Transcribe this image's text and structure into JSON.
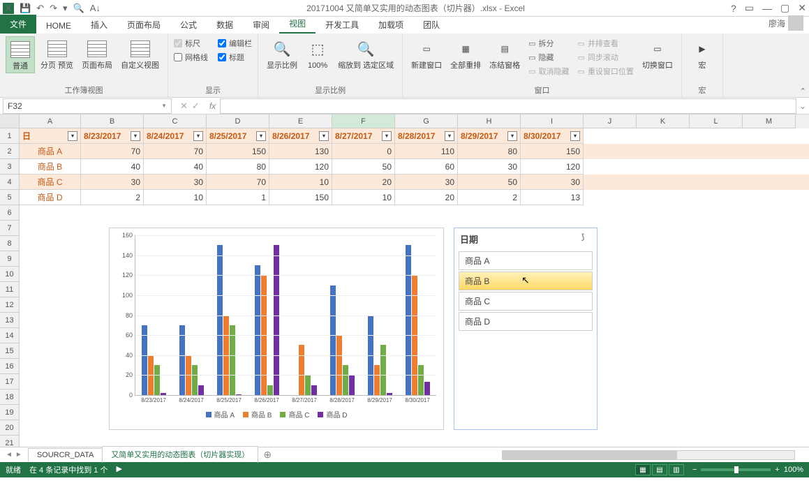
{
  "titlebar": {
    "title": "20171004 又简单又实用的动态图表（切片器）.xlsx - Excel"
  },
  "ribbon_tabs": {
    "file": "文件",
    "items": [
      "HOME",
      "插入",
      "页面布局",
      "公式",
      "数据",
      "审阅",
      "视图",
      "开发工具",
      "加载项",
      "团队"
    ],
    "active_index": 6,
    "user": "廖海"
  },
  "ribbon": {
    "group1": {
      "label": "工作簿视图",
      "btns": [
        "普通",
        "分页\n预览",
        "页面布局",
        "自定义视图"
      ]
    },
    "group2": {
      "label": "显示",
      "ruler": "标尺",
      "formula_bar": "编辑栏",
      "gridlines": "网格线",
      "headings": "标题",
      "ruler_checked": true,
      "formula_bar_checked": true,
      "gridlines_checked": false,
      "headings_checked": true
    },
    "group3": {
      "label": "显示比例",
      "btns": [
        "显示比例",
        "100%",
        "缩放到\n选定区域"
      ]
    },
    "group4": {
      "label": "窗口",
      "btns": [
        "新建窗口",
        "全部重排",
        "冻结窗格"
      ],
      "side": [
        "拆分",
        "隐藏",
        "取消隐藏"
      ],
      "side2": [
        "并排查看",
        "同步滚动",
        "重设窗口位置"
      ],
      "switch": "切换窗口"
    },
    "group5": {
      "label": "宏",
      "btn": "宏"
    }
  },
  "namebox": "F32",
  "columns": [
    "A",
    "B",
    "C",
    "D",
    "E",
    "F",
    "G",
    "H",
    "I",
    "J",
    "K",
    "L",
    "M"
  ],
  "table": {
    "header": [
      "日",
      "8/23/2017",
      "8/24/2017",
      "8/25/2017",
      "8/26/2017",
      "8/27/2017",
      "8/28/2017",
      "8/29/2017",
      "8/30/2017"
    ],
    "rows": [
      {
        "name": "商品 A",
        "vals": [
          70,
          70,
          150,
          130,
          0,
          110,
          80,
          150
        ]
      },
      {
        "name": "商品 B",
        "vals": [
          40,
          40,
          80,
          120,
          50,
          60,
          30,
          120
        ]
      },
      {
        "name": "商品 C",
        "vals": [
          30,
          30,
          70,
          10,
          20,
          30,
          50,
          30
        ]
      },
      {
        "name": "商品 D",
        "vals": [
          2,
          10,
          1,
          150,
          10,
          20,
          2,
          13
        ]
      }
    ]
  },
  "chart_data": {
    "type": "bar",
    "categories": [
      "8/23/2017",
      "8/24/2017",
      "8/25/2017",
      "8/26/2017",
      "8/27/2017",
      "8/28/2017",
      "8/29/2017",
      "8/30/2017"
    ],
    "series": [
      {
        "name": "商品 A",
        "values": [
          70,
          70,
          150,
          130,
          0,
          110,
          80,
          150
        ],
        "color": "#4472c4"
      },
      {
        "name": "商品 B",
        "values": [
          40,
          40,
          80,
          120,
          50,
          60,
          30,
          120
        ],
        "color": "#ed7d31"
      },
      {
        "name": "商品 C",
        "values": [
          30,
          30,
          70,
          10,
          20,
          30,
          50,
          30
        ],
        "color": "#70ad47"
      },
      {
        "name": "商品 D",
        "values": [
          2,
          10,
          1,
          150,
          10,
          20,
          2,
          13
        ],
        "color": "#7030a0"
      }
    ],
    "ylim": [
      0,
      160
    ],
    "y_ticks": [
      0,
      20,
      40,
      60,
      80,
      100,
      120,
      140,
      160
    ]
  },
  "slicer": {
    "title": "日期",
    "items": [
      "商品 A",
      "商品 B",
      "商品 C",
      "商品 D"
    ],
    "selected_index": 1
  },
  "sheets": {
    "tabs": [
      "SOURCR_DATA",
      "又简单又实用的动态图表（切片器实现）"
    ],
    "active_index": 1
  },
  "statusbar": {
    "ready": "就绪",
    "info": "在 4 条记录中找到 1 个",
    "zoom": "100%"
  }
}
